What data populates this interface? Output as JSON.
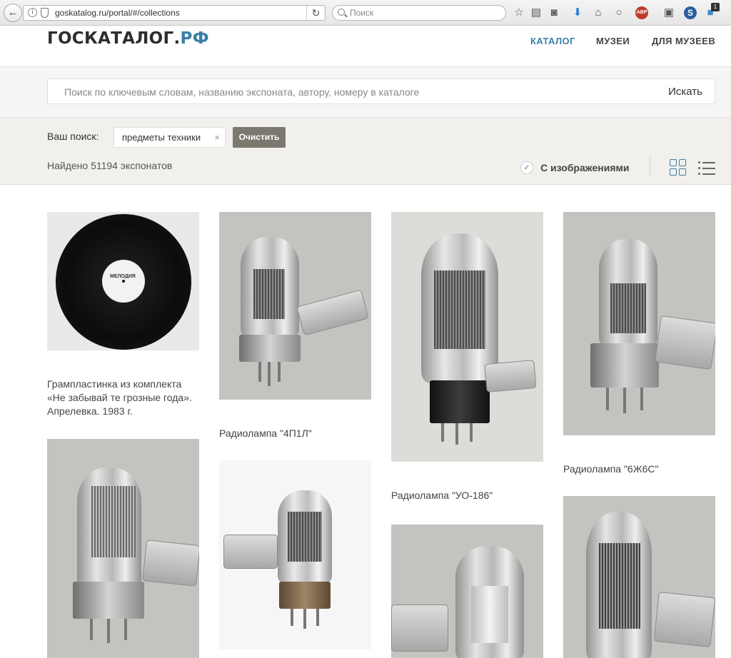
{
  "browser": {
    "url": "goskatalog.ru/portal/#/collections",
    "search_placeholder": "Поиск",
    "back_glyph": "←",
    "reload_glyph": "↻",
    "abp_label": "ABP",
    "s_label": "S",
    "badge_count": "1",
    "icons": [
      "bookmark-star-icon",
      "reading-list-icon",
      "pocket-icon",
      "download-icon",
      "home-icon",
      "chat-icon",
      "adblock-icon",
      "shield-extension-icon",
      "s-extension-icon",
      "notification-icon"
    ]
  },
  "header": {
    "logo_main": "ГОСКАТАЛОГ.",
    "logo_suffix": "РФ",
    "nav": [
      "КАТАЛОГ",
      "МУЗЕИ",
      "ДЛЯ МУЗЕЕВ"
    ],
    "active_nav": "КАТАЛОГ"
  },
  "search": {
    "placeholder": "Поиск по ключевым словам, названию экспоната, автору, номеру в каталоге",
    "button": "Искать"
  },
  "filters": {
    "label": "Ваш поиск:",
    "chip": "предметы техники",
    "chip_close": "×",
    "clear_button": "Очистить",
    "found": "Найдено 51194 экспонатов",
    "with_images_label": "С изображениями",
    "with_images_checked": true,
    "check_glyph": "✓",
    "view_mode": "grid"
  },
  "items": [
    {
      "caption": "Грампластинка из комплекта «Не забывай те грозные года». Апрелевка. 1983 г.",
      "label_text": "МЕЛОДИЯ"
    },
    {
      "caption": "Радиолампа \"4П1Л\""
    },
    {
      "caption": "Радиолампа \"УО-186\""
    },
    {
      "caption": "Радиолампа \"6Ж6С\""
    },
    {
      "caption": ""
    },
    {
      "caption": ""
    },
    {
      "caption": ""
    },
    {
      "caption": ""
    }
  ],
  "colors": {
    "accent": "#3a7fa8",
    "clear_button": "#7a786f",
    "filter_bg": "#f1f0ec"
  }
}
